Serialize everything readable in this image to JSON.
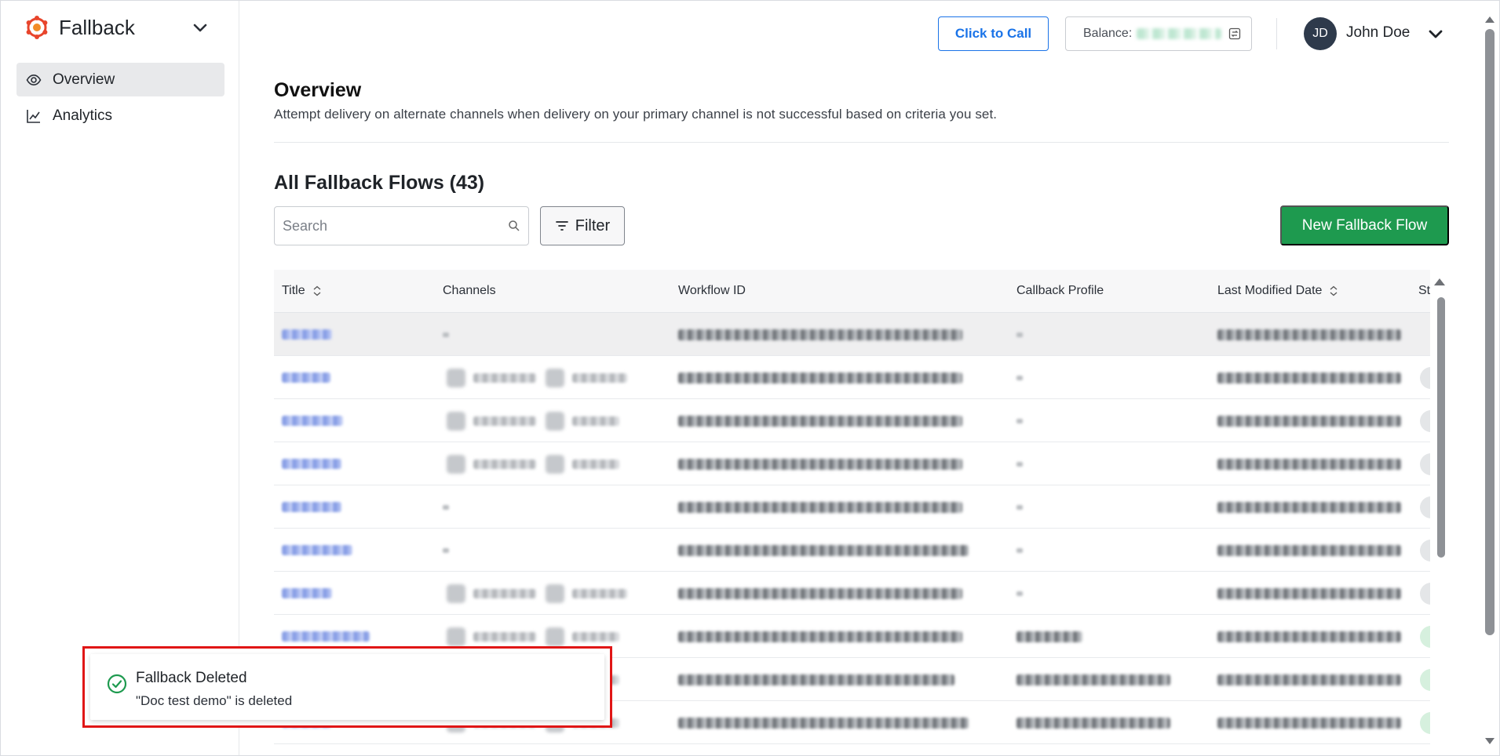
{
  "sidebar": {
    "brand": "Fallback",
    "items": [
      {
        "label": "Overview",
        "icon": "eye-icon",
        "active": true
      },
      {
        "label": "Analytics",
        "icon": "chart-line-icon",
        "active": false
      }
    ]
  },
  "topbar": {
    "call_label": "Click to Call",
    "balance_label": "Balance:",
    "avatar_initials": "JD",
    "user_name": "John Doe"
  },
  "header": {
    "title": "Overview",
    "subtitle": "Attempt delivery on alternate channels when delivery on your primary channel is not successful based on criteria you set."
  },
  "flows": {
    "title": "All Fallback Flows (43)",
    "search_placeholder": "Search",
    "filter_label": "Filter",
    "new_button": "New Fallback Flow"
  },
  "table": {
    "columns": [
      "Title",
      "Channels",
      "Workflow ID",
      "Callback Profile",
      "Last Modified Date",
      "St"
    ]
  },
  "toast": {
    "title": "Fallback Deleted",
    "message": "\"Doc test demo\" is deleted"
  },
  "colors": {
    "primary_blue": "#1a73e8",
    "success_green": "#1e9a4f",
    "highlight_red": "#e01616"
  }
}
